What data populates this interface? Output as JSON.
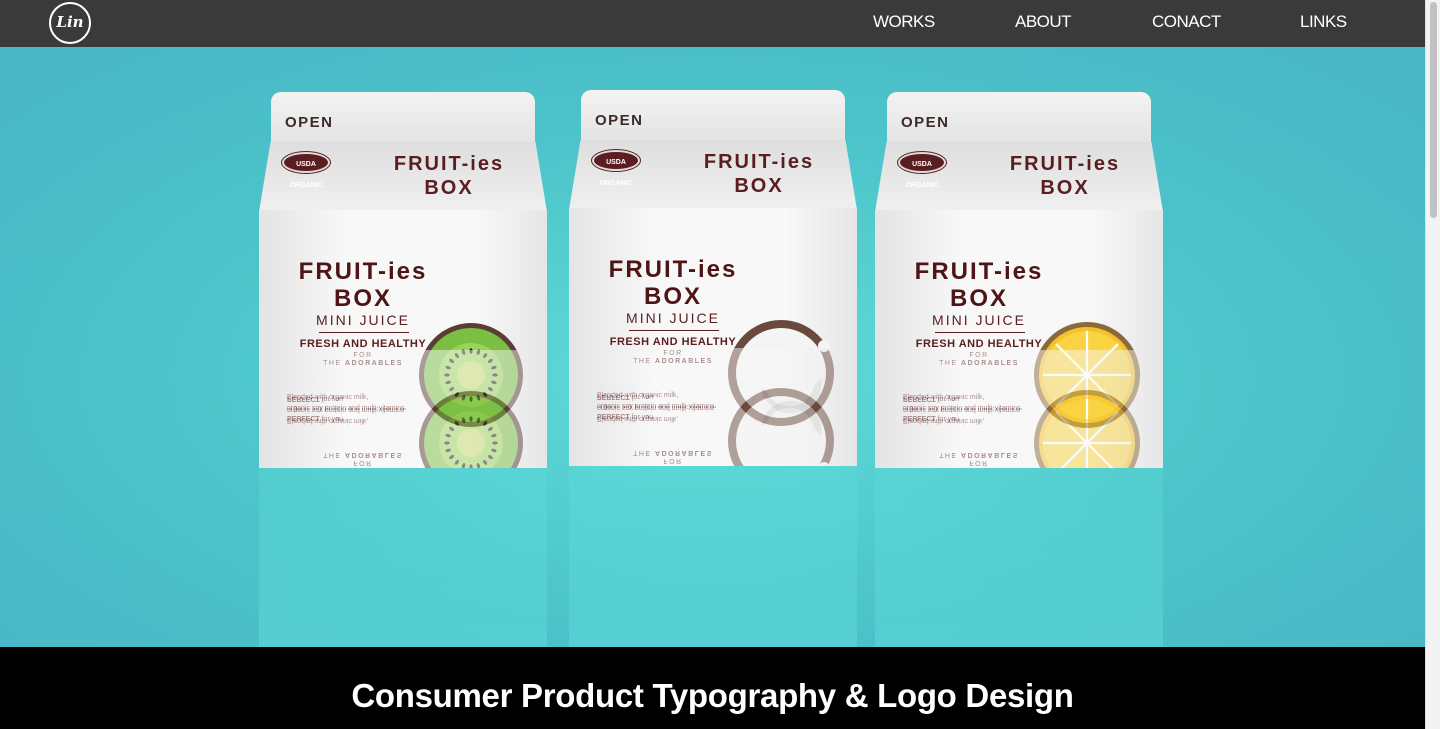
{
  "nav": {
    "logo_text": "Lin",
    "links": [
      "WORKS",
      "ABOUT",
      "CONACT",
      "LINKS"
    ]
  },
  "hero": {
    "cartons": [
      {
        "open_label": "OPEN",
        "usda_label": "USDA ORGANIC",
        "brand_top": "FRUIT-ies",
        "brand_bottom": "BOX",
        "title_top": "FRUIT-ies",
        "title_bottom": "BOX",
        "subtitle": "MINI JUICE",
        "tagline": "FRESH AND HEALTHY",
        "for_line": "FOR",
        "adorables_prefix": "THE ",
        "adorables_bold": "ADORABLES",
        "desc_line1": "Blended with organic milk,",
        "desc_line2": "organic soy protein and multi-vitamins.",
        "desc_bold": "PERFECT",
        "desc_tail": " for you.",
        "fruit_icon": "kiwi-icon"
      },
      {
        "open_label": "OPEN",
        "usda_label": "USDA ORGANIC",
        "brand_top": "FRUIT-ies",
        "brand_bottom": "BOX",
        "title_top": "FRUIT-ies",
        "title_bottom": "BOX",
        "subtitle": "MINI JUICE",
        "tagline": "FRESH AND HEALTHY",
        "for_line": "FOR",
        "adorables_prefix": "THE ",
        "adorables_bold": "ADORABLES",
        "desc_line1": "Blended with organic milk,",
        "desc_line2": "organic soy protein and multi-vitamins.",
        "desc_bold": "PERFECT",
        "desc_tail": " for you.",
        "fruit_icon": "coconut-icon"
      },
      {
        "open_label": "OPEN",
        "usda_label": "USDA ORGANIC",
        "brand_top": "FRUIT-ies",
        "brand_bottom": "BOX",
        "title_top": "FRUIT-ies",
        "title_bottom": "BOX",
        "subtitle": "MINI JUICE",
        "tagline": "FRESH AND HEALTHY",
        "for_line": "FOR",
        "adorables_prefix": "THE ",
        "adorables_bold": "ADORABLES",
        "desc_line1": "Blended with organic milk,",
        "desc_line2": "organic soy protein and multi-vitamins.",
        "desc_bold": "PERFECT",
        "desc_tail": " for you.",
        "fruit_icon": "lemon-icon"
      }
    ]
  },
  "caption": "Consumer Product Typography & Logo Design",
  "colors": {
    "navbar": "#3a3a3a",
    "hero_bg": "#4bc3c9",
    "brand_maroon": "#5b1e20",
    "caption_bg": "#000000"
  }
}
